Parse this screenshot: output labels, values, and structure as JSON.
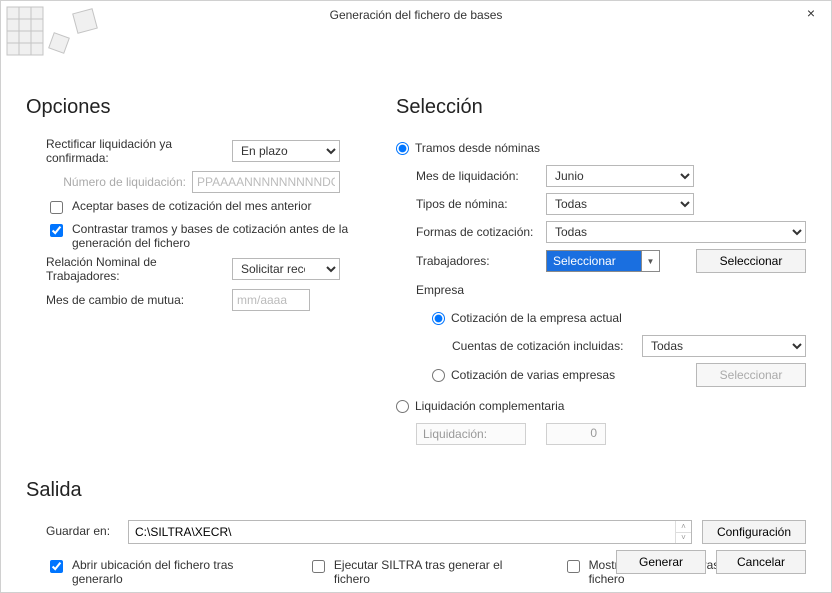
{
  "window": {
    "title": "Generación del fichero de bases",
    "close": "×"
  },
  "opciones": {
    "heading": "Opciones",
    "rectificar_label": "Rectificar liquidación ya confirmada:",
    "rectificar_value": "En plazo",
    "numero_liq_label": "Número de liquidación:",
    "numero_liq_placeholder": "PPAAAANNNNNNNNNDC",
    "aceptar_label": "Aceptar bases de cotización del mes anterior",
    "contrastar_label": "Contrastar tramos y bases de cotización antes de la generación del fichero",
    "rnt_label": "Relación Nominal de Trabajadores:",
    "rnt_value": "Solicitar recepció",
    "mes_cambio_label": "Mes de cambio de mutua:",
    "mes_cambio_placeholder": "mm/aaaa"
  },
  "seleccion": {
    "heading": "Selección",
    "tramos_radio": "Tramos desde nóminas",
    "mes_liq_label": "Mes de liquidación:",
    "mes_liq_value": "Junio",
    "tipos_label": "Tipos de nómina:",
    "tipos_value": "Todas",
    "formas_label": "Formas de cotización:",
    "formas_value": "Todas",
    "trabajadores_label": "Trabajadores:",
    "trabajadores_value": "Seleccionar",
    "seleccionar_btn": "Seleccionar",
    "empresa_heading": "Empresa",
    "cot_actual_radio": "Cotización de la empresa actual",
    "cuentas_label": "Cuentas de cotización incluidas:",
    "cuentas_value": "Todas",
    "cot_varias_radio": "Cotización de varias empresas",
    "seleccionar_btn2": "Seleccionar",
    "liq_comp_radio": "Liquidación complementaria",
    "liq_ro_label": "Liquidación:",
    "liq_ro_value": "0"
  },
  "salida": {
    "heading": "Salida",
    "guardar_label": "Guardar en:",
    "path": "C:\\SILTRA\\XECR\\",
    "config_btn": "Configuración",
    "check1": "Abrir ubicación del fichero tras generarlo",
    "check2": "Ejecutar SILTRA tras generar el fichero",
    "check3": "Mostrar un resumen tras generar el fichero"
  },
  "footer": {
    "generar": "Generar",
    "cancelar": "Cancelar"
  }
}
